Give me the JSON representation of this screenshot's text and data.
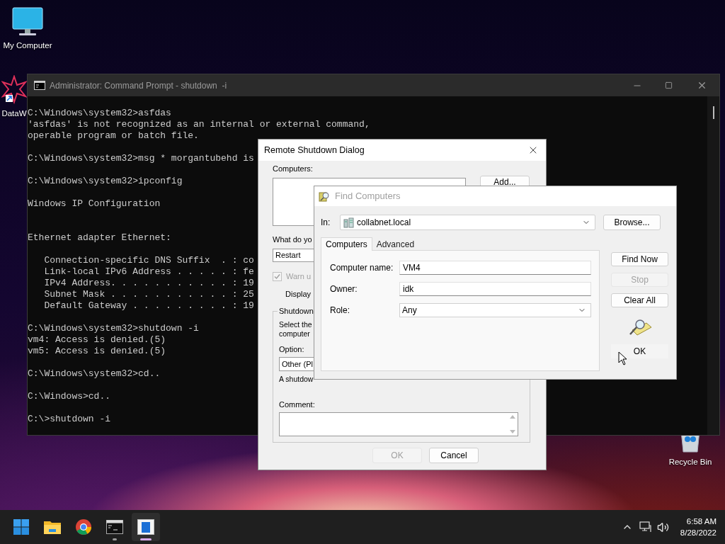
{
  "desktop_icons": [
    {
      "label": "My Computer",
      "kind": "monitor"
    },
    {
      "label": "DataW",
      "kind": "app"
    },
    {
      "label": "Recycle Bin",
      "kind": "bin"
    }
  ],
  "cmd_window": {
    "title": "Administrator: Command Prompt - shutdown  -i",
    "blocks": [
      {
        "kind": "normal",
        "lines": [
          "C:\\Windows\\system32>asfdas",
          "'asfdas' is not recognized as an internal or external command,",
          "operable program or batch file."
        ]
      },
      {
        "kind": "normal",
        "lines": [
          "C:\\Windows\\system32>msg * morgantubehd is"
        ]
      },
      {
        "kind": "normal",
        "lines": [
          "C:\\Windows\\system32>ipconfig"
        ]
      },
      {
        "kind": "normal",
        "lines": [
          "Windows IP Configuration"
        ]
      },
      {
        "kind": "section",
        "lines": [
          "Ethernet adapter Ethernet:"
        ]
      },
      {
        "kind": "normal",
        "lines": [
          "   Connection-specific DNS Suffix  . : co",
          "   Link-local IPv6 Address . . . . . : fe",
          "   IPv4 Address. . . . . . . . . . . : 19",
          "   Subnet Mask . . . . . . . . . . . : 25",
          "   Default Gateway . . . . . . . . . : 19"
        ]
      },
      {
        "kind": "normal",
        "lines": [
          "C:\\Windows\\system32>shutdown -i",
          "vm4: Access is denied.(5)",
          "vm5: Access is denied.(5)"
        ]
      },
      {
        "kind": "normal",
        "lines": [
          "C:\\Windows\\system32>cd.."
        ]
      },
      {
        "kind": "normal",
        "lines": [
          "C:\\Windows>cd.."
        ]
      },
      {
        "kind": "normal",
        "lines": [
          "C:\\>shutdown -i"
        ]
      }
    ]
  },
  "remote_shutdown": {
    "title": "Remote Shutdown Dialog",
    "computers_label": "Computers:",
    "add_button": "Add...",
    "action_label": "What do yo",
    "action_value": "Restart",
    "warn": {
      "label": "Warn u",
      "checked": true,
      "disabled": true
    },
    "display_label": "Display",
    "group_label": "Shutdown",
    "group_text": [
      "Select the",
      "computer"
    ],
    "option_label": "Option:",
    "option_value": "Other (Pl",
    "notice": "A shutdow",
    "comment_label": "Comment:",
    "buttons": [
      {
        "label": "OK",
        "disabled": true
      },
      {
        "label": "Cancel",
        "disabled": false
      }
    ]
  },
  "find_computers": {
    "title": "Find Computers",
    "in_label": "In:",
    "in_value": "collabnet.local",
    "browse_button": "Browse...",
    "tabs": [
      {
        "label": "Computers",
        "selected": true
      },
      {
        "label": "Advanced",
        "selected": false
      }
    ],
    "fields": [
      {
        "label": "Computer name:",
        "value": "VM4",
        "kind": "text"
      },
      {
        "label": "Owner:",
        "value": "idk",
        "kind": "text"
      },
      {
        "label": "Role:",
        "value": "Any",
        "kind": "select"
      }
    ],
    "side_buttons": [
      {
        "label": "Find Now",
        "disabled": false
      },
      {
        "label": "Stop",
        "disabled": true
      },
      {
        "label": "Clear All",
        "disabled": false
      }
    ],
    "ok_button": "OK"
  },
  "taskbar": {
    "apps": [
      {
        "kind": "start",
        "running": false,
        "selected": false
      },
      {
        "kind": "explorer",
        "running": false,
        "selected": false
      },
      {
        "kind": "chrome",
        "running": false,
        "selected": false
      },
      {
        "kind": "terminal",
        "running": true,
        "selected": false
      },
      {
        "kind": "dialog",
        "running": true,
        "selected": true
      }
    ],
    "time": "6:58 AM",
    "date": "8/28/2022"
  }
}
